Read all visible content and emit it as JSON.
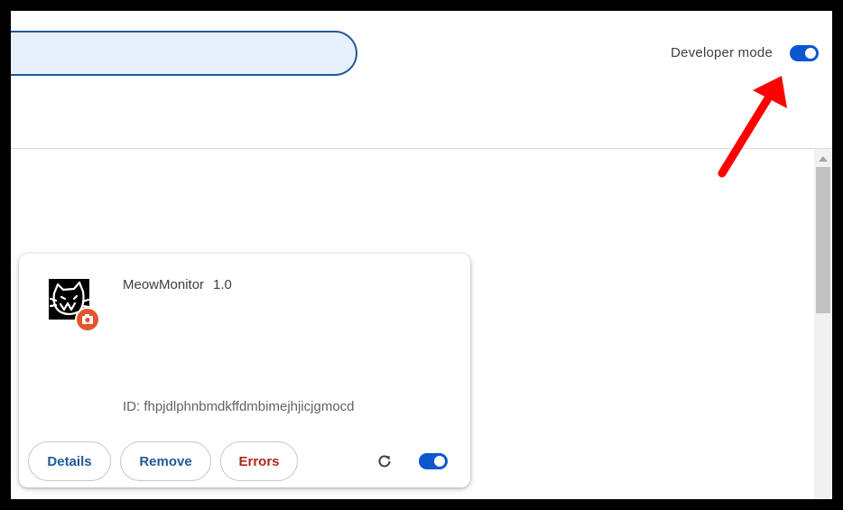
{
  "header": {
    "search": {
      "placeholder": "",
      "value": ""
    },
    "developer_mode": {
      "label": "Developer mode",
      "enabled": true
    }
  },
  "extension": {
    "name": "MeowMonitor",
    "version": "1.0",
    "id_text": "ID: fhpjdlphnbmdkffdmbimejhjicjgmocd",
    "icon": "cat-face-icon",
    "badge_icon": "camera-badge-icon",
    "enabled": true,
    "buttons": {
      "details": "Details",
      "remove": "Remove",
      "errors": "Errors"
    },
    "reload_icon": "reload-icon"
  },
  "annotation": {
    "icon": "red-arrow-icon",
    "color": "#ff0000"
  },
  "colors": {
    "accent": "#0b57d0",
    "error": "#b3261e",
    "button_text": "#1f5a96"
  }
}
